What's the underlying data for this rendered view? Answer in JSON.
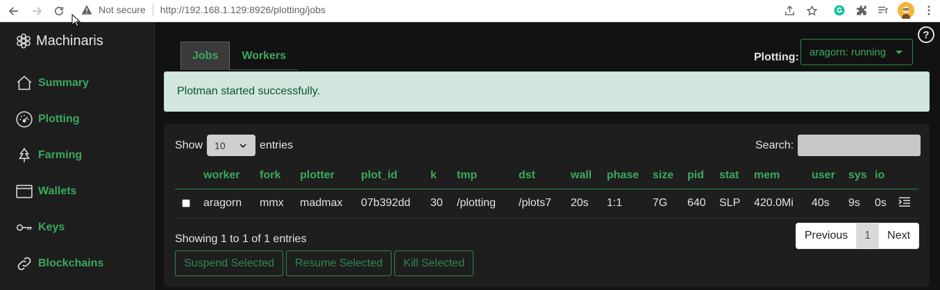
{
  "browser": {
    "security_text": "Not secure",
    "url": "http://192.168.1.129:8926/plotting/jobs"
  },
  "sidebar": {
    "brand": "Machinaris",
    "items": [
      {
        "label": "Summary",
        "icon": "house-icon"
      },
      {
        "label": "Plotting",
        "icon": "speedometer-icon"
      },
      {
        "label": "Farming",
        "icon": "tree-icon"
      },
      {
        "label": "Wallets",
        "icon": "wallet-icon"
      },
      {
        "label": "Keys",
        "icon": "key-icon"
      },
      {
        "label": "Blockchains",
        "icon": "link-icon"
      }
    ]
  },
  "tabs": [
    {
      "label": "Jobs",
      "active": true
    },
    {
      "label": "Workers",
      "active": false
    }
  ],
  "plotting": {
    "label": "Plotting:",
    "selected": "aragorn: running"
  },
  "alert": "Plotman started successfully.",
  "table_controls": {
    "show_label": "Show",
    "page_size": "10",
    "entries_label": "entries",
    "search_label": "Search:"
  },
  "table": {
    "headers": [
      "worker",
      "fork",
      "plotter",
      "plot_id",
      "k",
      "tmp",
      "dst",
      "wall",
      "phase",
      "size",
      "pid",
      "stat",
      "mem",
      "user",
      "sys",
      "io"
    ],
    "rows": [
      [
        "aragorn",
        "mmx",
        "madmax",
        "07b392dd",
        "30",
        "/plotting",
        "/plots7",
        "20s",
        "1:1",
        "7G",
        "640",
        "SLP",
        "420.0Mi",
        "40s",
        "9s",
        "0s"
      ]
    ]
  },
  "footer": {
    "info": "Showing 1 to 1 of 1 entries",
    "pagination": {
      "previous": "Previous",
      "current": "1",
      "next": "Next"
    }
  },
  "actions": [
    "Suspend Selected",
    "Resume Selected",
    "Kill Selected"
  ],
  "colors": {
    "accent": "#3aa95d",
    "alert_bg": "#d1e7dd",
    "alert_text": "#0f5132"
  }
}
